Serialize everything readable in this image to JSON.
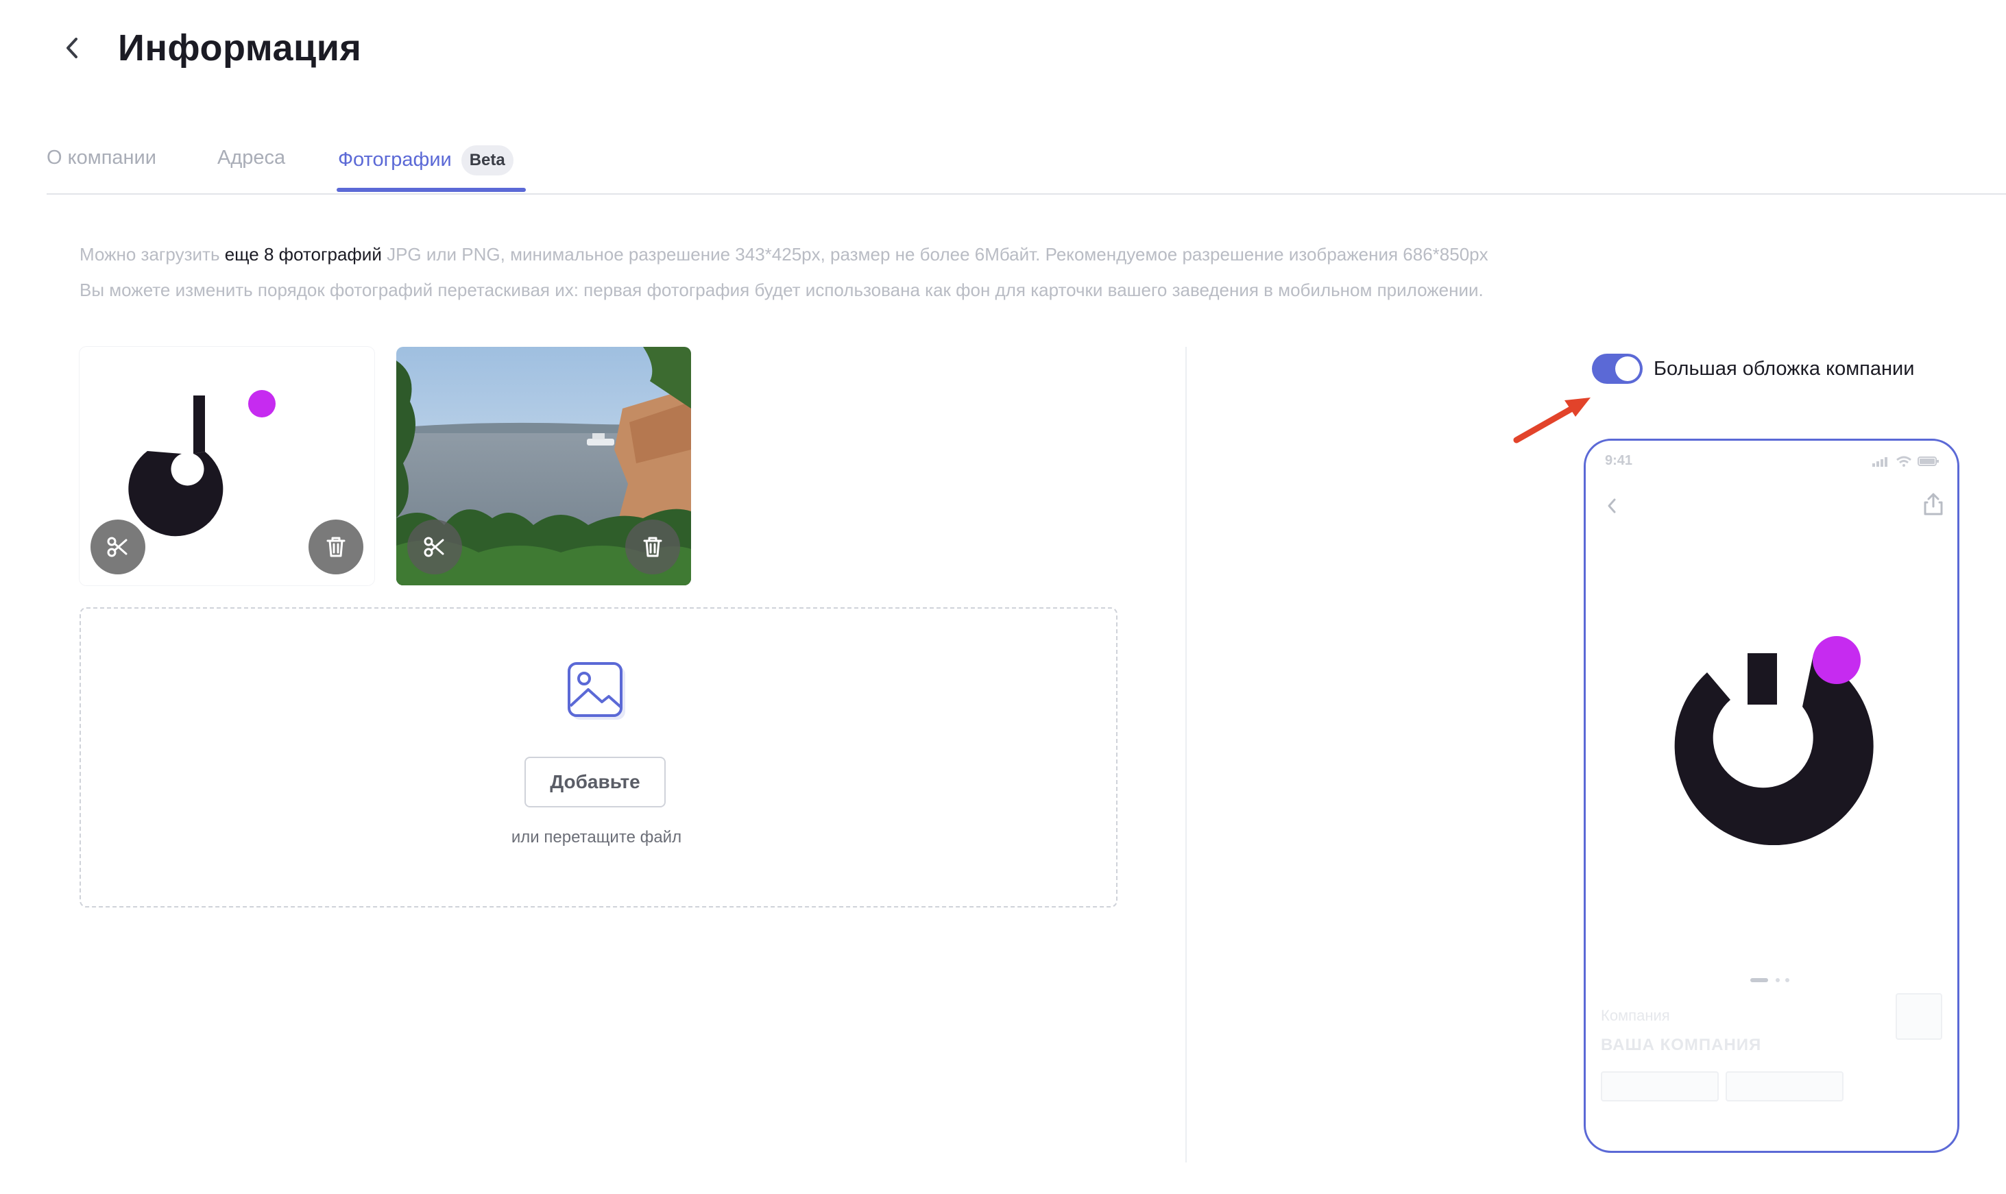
{
  "header": {
    "title": "Информация"
  },
  "tabs": [
    {
      "label": "О компании"
    },
    {
      "label": "Адреса"
    },
    {
      "label": "Фотографии",
      "badge": "Beta",
      "active": true
    }
  ],
  "info": {
    "line1_prefix": "Можно загрузить ",
    "line1_highlight": "еще 8 фотографий",
    "line1_suffix": " JPG или PNG, минимальное разрешение 343*425px, размер не более 6Мбайт. Рекомендуемое разрешение изображения 686*850px",
    "line2": "Вы можете изменить порядок фотографий перетаскивая их: первая фотография будет использована как фон для карточки вашего заведения в мобильном приложении."
  },
  "photos": [
    {
      "icons": [
        "crop-icon",
        "trash-icon"
      ]
    },
    {
      "icons": [
        "crop-icon",
        "trash-icon"
      ]
    }
  ],
  "dropzone": {
    "add_label": "Добавьте",
    "hint": "или перетащите файл",
    "icon": "image-upload-icon"
  },
  "cover": {
    "toggle_on": true,
    "label": "Большая обложка компании"
  },
  "preview": {
    "time": "9:41",
    "company_label": "Компания",
    "company_name": "ВАША КОМПАНИЯ"
  },
  "colors": {
    "accent": "#5b69d6",
    "logo_dark": "#1a1620",
    "logo_dot": "#c62bf0",
    "arrow": "#e2432a"
  }
}
